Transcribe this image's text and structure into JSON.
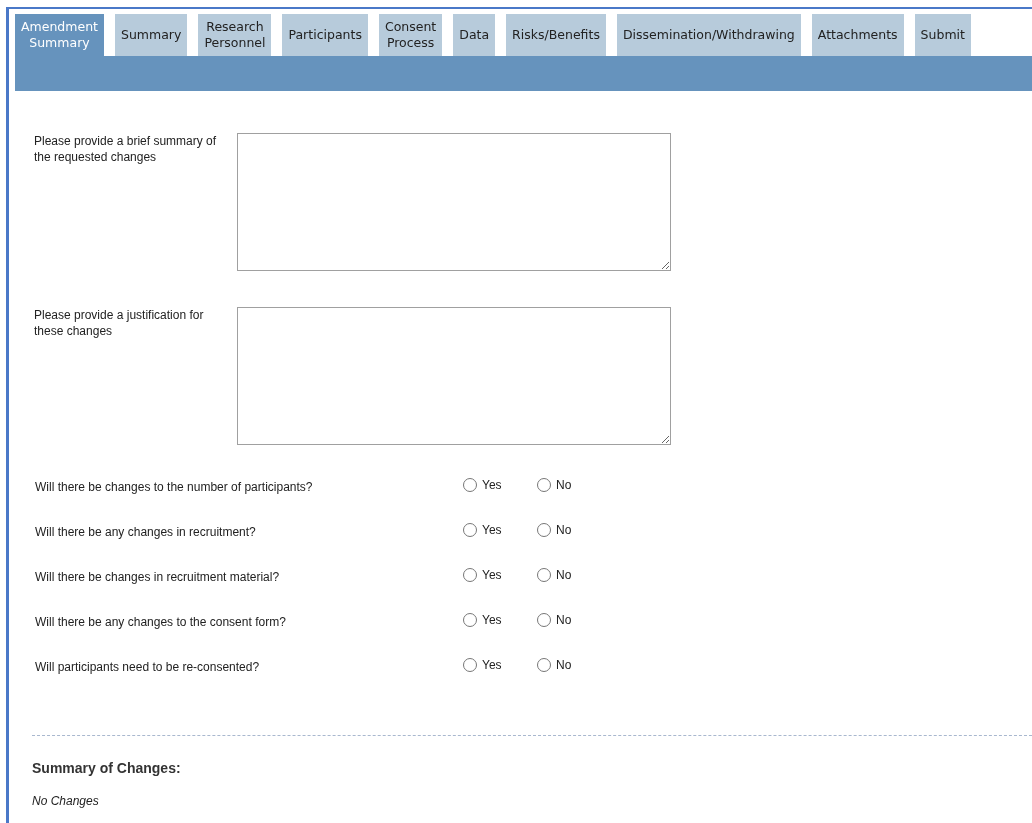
{
  "tabs": [
    {
      "lines": [
        "Amendment",
        "Summary"
      ],
      "selected": true
    },
    {
      "lines": [
        "Summary"
      ],
      "selected": false
    },
    {
      "lines": [
        "Research",
        "Personnel"
      ],
      "selected": false
    },
    {
      "lines": [
        "Participants"
      ],
      "selected": false
    },
    {
      "lines": [
        "Consent",
        "Process"
      ],
      "selected": false
    },
    {
      "lines": [
        "Data"
      ],
      "selected": false
    },
    {
      "lines": [
        "Risks/Benefits"
      ],
      "selected": false
    },
    {
      "lines": [
        "Dissemination/Withdrawing"
      ],
      "selected": false
    },
    {
      "lines": [
        "Attachments"
      ],
      "selected": false
    },
    {
      "lines": [
        "Submit"
      ],
      "selected": false
    }
  ],
  "text_fields": [
    {
      "label": "Please provide a brief summary of the requested changes"
    },
    {
      "label": "Please provide a justification for these changes"
    }
  ],
  "questions": [
    {
      "text": "Will there be changes to the number of participants?",
      "options": [
        {
          "label": "Yes",
          "selected": false
        },
        {
          "label": "No",
          "selected": false
        }
      ]
    },
    {
      "text": "Will there be any changes in recruitment?",
      "options": [
        {
          "label": "Yes",
          "selected": false
        },
        {
          "label": "No",
          "selected": false
        }
      ]
    },
    {
      "text": "Will there be changes in recruitment material?",
      "options": [
        {
          "label": "Yes",
          "selected": false
        },
        {
          "label": "No",
          "selected": false
        }
      ]
    },
    {
      "text": "Will there be any changes to the consent form?",
      "options": [
        {
          "label": "Yes",
          "selected": false
        },
        {
          "label": "No",
          "selected": false
        }
      ]
    },
    {
      "text": "Will participants need to be re-consented?",
      "options": [
        {
          "label": "Yes",
          "selected": false
        },
        {
          "label": "No",
          "selected": false
        }
      ]
    }
  ],
  "summary": {
    "heading": "Summary of Changes:",
    "text": "No Changes"
  }
}
